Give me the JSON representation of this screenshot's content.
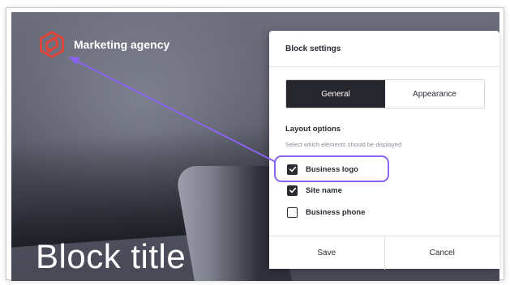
{
  "site": {
    "name": "Marketing agency",
    "block_title": "Block title"
  },
  "panel": {
    "title": "Block settings",
    "tabs": [
      {
        "label": "General",
        "active": true
      },
      {
        "label": "Appearance",
        "active": false
      }
    ],
    "section": {
      "title": "Layout options",
      "subtitle": "Select which elements should be displayed"
    },
    "options": [
      {
        "label": "Business logo",
        "checked": true
      },
      {
        "label": "Site name",
        "checked": true
      },
      {
        "label": "Business phone",
        "checked": false
      }
    ],
    "footer": {
      "save_label": "Save",
      "cancel_label": "Cancel"
    }
  },
  "colors": {
    "logo_accent": "#e0453a",
    "annotation": "#8a63f0",
    "tab_active_bg": "#26262d"
  },
  "icons": {
    "logo": "hexagon-logo-icon",
    "check": "checkmark-icon"
  }
}
